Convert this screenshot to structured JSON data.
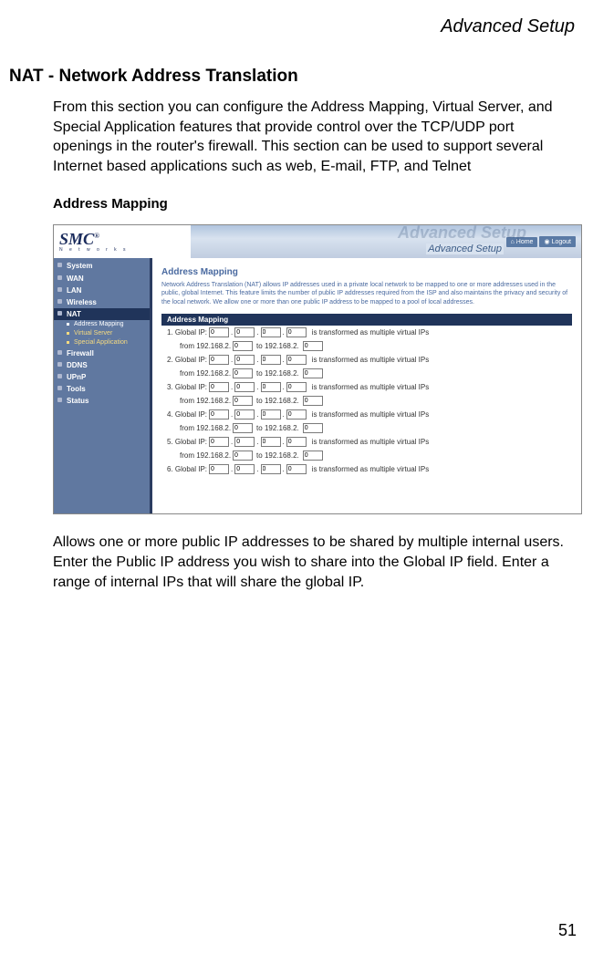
{
  "header": {
    "title": "Advanced Setup"
  },
  "section": {
    "title": "NAT - Network Address Translation"
  },
  "intro": "From this section you can configure the Address Mapping, Virtual Server, and Special Application features that provide control over the TCP/UDP port openings in the router's firewall. This section can be used to support several Internet based applications such as web, E-mail, FTP, and Telnet",
  "subsection": {
    "title": "Address Mapping"
  },
  "router": {
    "brand": "SMC",
    "brand_sup": "®",
    "networks": "N e t w o r k s",
    "banner_ghost": "Advanced Setup",
    "banner_sub": "Advanced Setup",
    "btn_home": "Home",
    "btn_logout": "Logout",
    "sidebar": {
      "items": [
        {
          "label": "System",
          "type": "item"
        },
        {
          "label": "WAN",
          "type": "item"
        },
        {
          "label": "LAN",
          "type": "item"
        },
        {
          "label": "Wireless",
          "type": "item"
        },
        {
          "label": "NAT",
          "type": "active"
        },
        {
          "label": "Address Mapping",
          "type": "sub-current"
        },
        {
          "label": "Virtual Server",
          "type": "sub"
        },
        {
          "label": "Special Application",
          "type": "sub"
        },
        {
          "label": "Firewall",
          "type": "item"
        },
        {
          "label": "DDNS",
          "type": "item"
        },
        {
          "label": "UPnP",
          "type": "item"
        },
        {
          "label": "Tools",
          "type": "item"
        },
        {
          "label": "Status",
          "type": "item"
        }
      ]
    },
    "main": {
      "heading": "Address Mapping",
      "desc": "Network Address Translation (NAT) allows IP addresses used in a private local network to be mapped to one or more addresses used in the public, global Internet. This feature limits the number of public IP addresses required from the ISP and also maintains the privacy and security of the local network. We allow one or more than one public IP address to be mapped to a pool of local addresses.",
      "table_header": "Address Mapping",
      "rows": [
        {
          "n": "1",
          "global_label": "Global IP:",
          "o1": "0",
          "o2": "0",
          "o3": "0",
          "o4": "0",
          "suffix": "is transformed as multiple virtual IPs",
          "from_prefix": "from  192.168.2.",
          "f1": "0",
          "to_label": "to 192.168.2.",
          "f2": "0"
        },
        {
          "n": "2",
          "global_label": "Global IP:",
          "o1": "0",
          "o2": "0",
          "o3": "0",
          "o4": "0",
          "suffix": "is transformed as multiple virtual IPs",
          "from_prefix": "from  192.168.2.",
          "f1": "0",
          "to_label": "to 192.168.2.",
          "f2": "0"
        },
        {
          "n": "3",
          "global_label": "Global IP:",
          "o1": "0",
          "o2": "0",
          "o3": "0",
          "o4": "0",
          "suffix": "is transformed as multiple virtual IPs",
          "from_prefix": "from  192.168.2.",
          "f1": "0",
          "to_label": "to 192.168.2.",
          "f2": "0"
        },
        {
          "n": "4",
          "global_label": "Global IP:",
          "o1": "0",
          "o2": "0",
          "o3": "0",
          "o4": "0",
          "suffix": "is transformed as multiple virtual IPs",
          "from_prefix": "from  192.168.2.",
          "f1": "0",
          "to_label": "to 192.168.2.",
          "f2": "0"
        },
        {
          "n": "5",
          "global_label": "Global IP:",
          "o1": "0",
          "o2": "0",
          "o3": "0",
          "o4": "0",
          "suffix": "is transformed as multiple virtual IPs",
          "from_prefix": "from  192.168.2.",
          "f1": "0",
          "to_label": "to 192.168.2.",
          "f2": "0"
        },
        {
          "n": "6",
          "global_label": "Global IP:",
          "o1": "0",
          "o2": "0",
          "o3": "0",
          "o4": "0",
          "suffix": "is transformed as multiple virtual IPs"
        }
      ]
    }
  },
  "outro": "Allows one or more public IP addresses to be shared by multiple internal users. Enter the Public IP address you wish to share into the Global IP field. Enter a range of internal IPs that will share the global IP.",
  "page_num": "51"
}
